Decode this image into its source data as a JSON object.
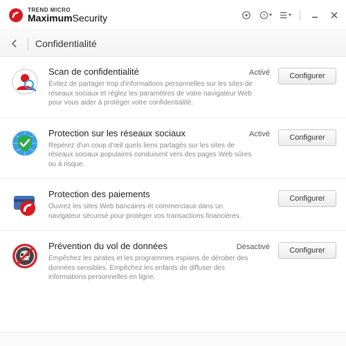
{
  "brand": {
    "top": "TREND MICRO",
    "bold": "Maximum",
    "thin": "Security"
  },
  "subheader": {
    "title": "Confidentialité"
  },
  "buttons": {
    "configure": "Configurer"
  },
  "rows": [
    {
      "title": "Scan de confidentialité",
      "status": "Activé",
      "desc": "Évitez de partager trop d'informations personnelles sur les sites de réseaux sociaux et réglez les paramètres de votre navigateur Web pour vous aider à protéger votre confidentialité."
    },
    {
      "title": "Protection sur les réseaux sociaux",
      "status": "Activé",
      "desc": "Repérez d'un coup d'œil quels liens partagés sur les sites de réseaux sociaux populaires conduisent vers des pages Web sûres ou à risque."
    },
    {
      "title": "Protection des paiements",
      "status": "",
      "desc": "Ouvrez les sites Web bancaires et commerciaux dans un navigateur sécurisé pour protéger vos transactions financières."
    },
    {
      "title": "Prévention du vol de données",
      "status": "Désactivé",
      "desc": "Empêchez les pirates et les programmes espions de dérober des données sensibles. Empêchez les enfants de diffuser des informations personnelles en ligne."
    }
  ]
}
